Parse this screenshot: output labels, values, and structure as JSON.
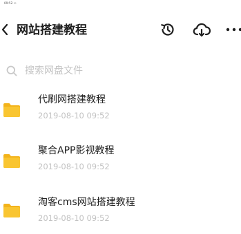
{
  "status_bar": {
    "time": "09:52 ☉"
  },
  "header": {
    "title": "网站搭建教程",
    "icons": [
      "back-icon",
      "history-icon",
      "cloud-download-icon",
      "more-icon"
    ]
  },
  "search": {
    "placeholder": "搜索网盘文件"
  },
  "files": [
    {
      "name": "代刷网搭建教程",
      "date": "2019-08-10  09:52"
    },
    {
      "name": "聚合APP影视教程",
      "date": "2019-08-10  09:52"
    },
    {
      "name": "淘客cms网站搭建教程",
      "date": "2019-08-10  09:52"
    }
  ],
  "colors": {
    "folder": "#f9c531",
    "folder_dark": "#f3b31b",
    "text_primary": "#1f1f1f",
    "text_secondary": "#c2c2c2"
  }
}
